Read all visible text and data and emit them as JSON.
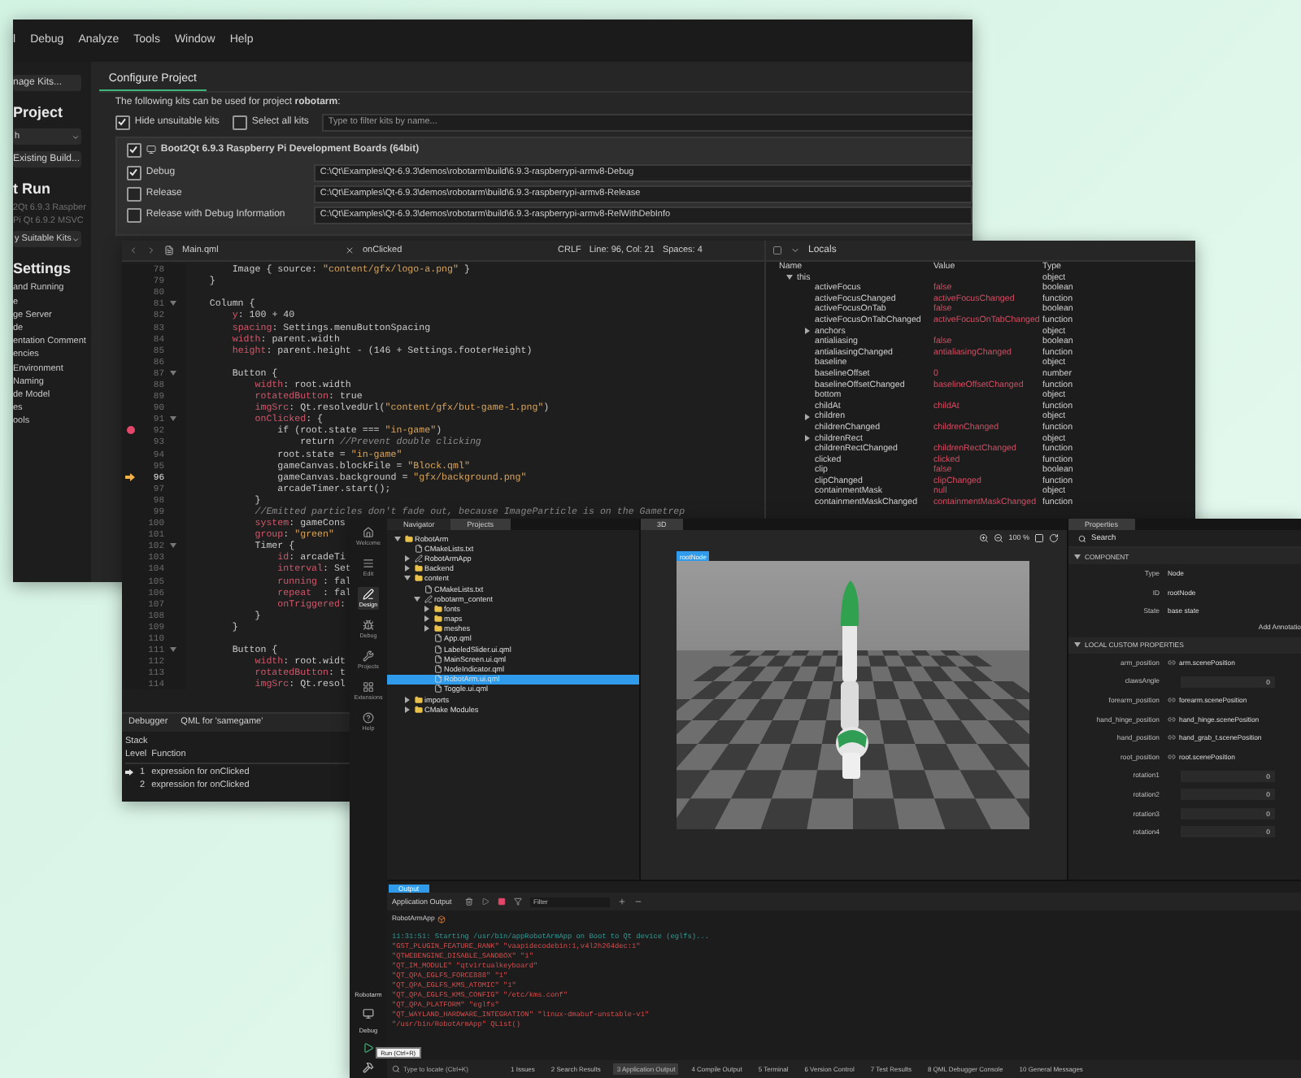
{
  "build_window": {
    "menu": [
      "l",
      "Debug",
      "Analyze",
      "Tools",
      "Window",
      "Help"
    ],
    "sidebar": [
      {
        "kind": "button",
        "text": "nage Kits..."
      },
      {
        "kind": "heading",
        "text": "Project"
      },
      {
        "kind": "dropdown",
        "text": "h"
      },
      {
        "kind": "button",
        "text": "Existing Build..."
      },
      {
        "kind": "heading",
        "text": "t Run"
      },
      {
        "kind": "faded",
        "text": "2Qt 6.9.3 Raspber"
      },
      {
        "kind": "faded",
        "text": "Pi Qt 6.9.2 MSVC"
      },
      {
        "kind": "dropdown",
        "text": "y Suitable Kits"
      },
      {
        "kind": "heading",
        "text": "Settings"
      },
      {
        "kind": "item",
        "text": "and Running"
      },
      {
        "kind": "item",
        "text": "e"
      },
      {
        "kind": "item",
        "text": "ge Server"
      },
      {
        "kind": "item",
        "text": "de"
      },
      {
        "kind": "item",
        "text": "entation Comment"
      },
      {
        "kind": "item",
        "text": "encies"
      },
      {
        "kind": "item",
        "text": "Environment"
      },
      {
        "kind": "item",
        "text": "Naming"
      },
      {
        "kind": "item",
        "text": "de Model"
      },
      {
        "kind": "item",
        "text": "es"
      },
      {
        "kind": "item",
        "text": "ools"
      }
    ],
    "tab": "Configure Project",
    "intro": "The following kits can be used for project **robotarm**:",
    "options": [
      {
        "label": "Hide unsuitable kits",
        "checked": true
      },
      {
        "label": "Select all kits",
        "checked": false
      }
    ],
    "filter_placeholder": "Type to filter kits by name...",
    "kit": {
      "name": "Boot2Qt 6.9.3 Raspberry Pi Development Boards (64bit)",
      "checked": true
    },
    "builds": [
      {
        "label": "Debug",
        "checked": true,
        "path": "C:\\Qt\\Examples\\Qt-6.9.3\\demos\\robotarm\\build\\6.9.3-raspberrypi-armv8-Debug"
      },
      {
        "label": "Release",
        "checked": false,
        "path": "C:\\Qt\\Examples\\Qt-6.9.3\\demos\\robotarm\\build\\6.9.3-raspberrypi-armv8-Release"
      },
      {
        "label": "Release with Debug Information",
        "checked": false,
        "path": "C:\\Qt\\Examples\\Qt-6.9.3\\demos\\robotarm\\build\\6.9.3-raspberrypi-armv8-RelWithDebInfo"
      }
    ]
  },
  "editor_window": {
    "file": "Main.qml",
    "symbol": "onClicked",
    "encoding": "CRLF",
    "position": "Line: 96, Col: 21",
    "indent": "Spaces: 4",
    "lines": [
      {
        "n": "78",
        "code": "        Image { source: \"content/gfx/logo-a.png\" }",
        "breakpoint": false,
        "current": false,
        "fold": false
      },
      {
        "n": "79",
        "code": "    }",
        "breakpoint": false,
        "current": false,
        "fold": false
      },
      {
        "n": "80",
        "breakpoint": false,
        "current": false,
        "fold": false
      },
      {
        "n": "81",
        "code": "    Column {",
        "breakpoint": false,
        "current": false,
        "fold": true
      },
      {
        "n": "82",
        "code": "        y: 100 + 40",
        "breakpoint": false,
        "current": false,
        "fold": false
      },
      {
        "n": "83",
        "code": "        spacing: Settings.menuButtonSpacing",
        "breakpoint": false,
        "current": false,
        "fold": false
      },
      {
        "n": "84",
        "code": "        width: parent.width",
        "breakpoint": false,
        "current": false,
        "fold": false
      },
      {
        "n": "85",
        "code": "        height: parent.height - (146 + Settings.footerHeight)",
        "breakpoint": false,
        "current": false,
        "fold": false
      },
      {
        "n": "86",
        "breakpoint": false,
        "current": false,
        "fold": false
      },
      {
        "n": "87",
        "code": "        Button {",
        "breakpoint": false,
        "current": false,
        "fold": true
      },
      {
        "n": "88",
        "code": "            width: root.width",
        "breakpoint": false,
        "current": false,
        "fold": false
      },
      {
        "n": "89",
        "code": "            rotatedButton: true",
        "breakpoint": false,
        "current": false,
        "fold": false
      },
      {
        "n": "90",
        "code": "            imgSrc: Qt.resolvedUrl(\"content/gfx/but-game-1.png\")",
        "breakpoint": false,
        "current": false,
        "fold": false
      },
      {
        "n": "91",
        "code": "            onClicked: {",
        "breakpoint": false,
        "current": false,
        "fold": true
      },
      {
        "n": "92",
        "code": "                if (root.state === \"in-game\")",
        "breakpoint": true,
        "current": false,
        "fold": false
      },
      {
        "n": "93",
        "code": "                    return //Prevent double clicking",
        "breakpoint": false,
        "current": false,
        "fold": false
      },
      {
        "n": "94",
        "code": "                root.state = \"in-game\"",
        "breakpoint": false,
        "current": false,
        "fold": false
      },
      {
        "n": "95",
        "code": "                gameCanvas.blockFile = \"Block.qml\"",
        "breakpoint": false,
        "current": false,
        "fold": false
      },
      {
        "n": "96",
        "code": "                gameCanvas.background = \"gfx/background.png\"",
        "breakpoint": false,
        "current": true,
        "fold": false
      },
      {
        "n": "97",
        "code": "                arcadeTimer.start();",
        "breakpoint": false,
        "current": false,
        "fold": false
      },
      {
        "n": "98",
        "code": "            }",
        "breakpoint": false,
        "current": false,
        "fold": false
      },
      {
        "n": "99",
        "code": "            //Emitted particles don't fade out, because ImageParticle is on the Gametrep",
        "breakpoint": false,
        "current": false,
        "fold": false
      },
      {
        "n": "100",
        "code": "            system: gameCons",
        "breakpoint": false,
        "current": false,
        "fold": false
      },
      {
        "n": "101",
        "code": "            group: \"green\"",
        "breakpoint": false,
        "current": false,
        "fold": false
      },
      {
        "n": "102",
        "code": "            Timer {",
        "breakpoint": false,
        "current": false,
        "fold": true
      },
      {
        "n": "103",
        "code": "                id: arcadeTi",
        "breakpoint": false,
        "current": false,
        "fold": false
      },
      {
        "n": "104",
        "code": "                interval: Set",
        "breakpoint": false,
        "current": false,
        "fold": false
      },
      {
        "n": "105",
        "code": "                running : fal",
        "breakpoint": false,
        "current": false,
        "fold": false
      },
      {
        "n": "106",
        "code": "                repeat  : fal",
        "breakpoint": false,
        "current": false,
        "fold": false
      },
      {
        "n": "107",
        "code": "                onTriggered:",
        "breakpoint": false,
        "current": false,
        "fold": false
      },
      {
        "n": "108",
        "code": "            }",
        "breakpoint": false,
        "current": false,
        "fold": false
      },
      {
        "n": "109",
        "code": "        }",
        "breakpoint": false,
        "current": false,
        "fold": false
      },
      {
        "n": "110",
        "breakpoint": false,
        "current": false,
        "fold": false
      },
      {
        "n": "111",
        "code": "        Button {",
        "breakpoint": false,
        "current": false,
        "fold": true
      },
      {
        "n": "112",
        "code": "            width: root.widt",
        "breakpoint": false,
        "current": false,
        "fold": false
      },
      {
        "n": "113",
        "code": "            rotatedButton: t",
        "breakpoint": false,
        "current": false,
        "fold": false
      },
      {
        "n": "114",
        "code": "            imgSrc: Qt.resol",
        "breakpoint": false,
        "current": false,
        "fold": false
      }
    ],
    "debugger": {
      "label": "Debugger",
      "engine": "QML for 'samegame'"
    },
    "stack": {
      "title": "Stack",
      "columns": [
        "Level",
        "Function"
      ],
      "rows": [
        {
          "level": "1",
          "function": "expression for onClicked",
          "current": true
        },
        {
          "level": "2",
          "function": "expression for onClicked",
          "current": false
        }
      ]
    },
    "locals": {
      "title": "Locals",
      "columns": [
        "Name",
        "Value",
        "Type"
      ],
      "rows": [
        {
          "name": "this",
          "type": "object",
          "expanded": true,
          "children": [
            {
              "name": "activeFocus",
              "value": "false",
              "type": "boolean"
            },
            {
              "name": "activeFocusChanged",
              "value": "activeFocusChanged",
              "type": "function"
            },
            {
              "name": "activeFocusOnTab",
              "value": "false",
              "type": "boolean"
            },
            {
              "name": "activeFocusOnTabChanged",
              "value": "activeFocusOnTabChanged",
              "type": "function"
            },
            {
              "name": "anchors",
              "type": "object",
              "expanded": false
            },
            {
              "name": "antialiasing",
              "value": "false",
              "type": "boolean"
            },
            {
              "name": "antialiasingChanged",
              "value": "antialiasingChanged",
              "type": "function"
            },
            {
              "name": "baseline",
              "type": "object"
            },
            {
              "name": "baselineOffset",
              "value": "0",
              "type": "number"
            },
            {
              "name": "baselineOffsetChanged",
              "value": "baselineOffsetChanged",
              "type": "function"
            },
            {
              "name": "bottom",
              "type": "object"
            },
            {
              "name": "childAt",
              "value": "childAt",
              "type": "function"
            },
            {
              "name": "children",
              "type": "object",
              "expanded": false
            },
            {
              "name": "childrenChanged",
              "value": "childrenChanged",
              "type": "function"
            },
            {
              "name": "childrenRect",
              "type": "object",
              "expanded": false
            },
            {
              "name": "childrenRectChanged",
              "value": "childrenRectChanged",
              "type": "function"
            },
            {
              "name": "clicked",
              "value": "clicked",
              "type": "function"
            },
            {
              "name": "clip",
              "value": "false",
              "type": "boolean"
            },
            {
              "name": "clipChanged",
              "value": "clipChanged",
              "type": "function"
            },
            {
              "name": "containmentMask",
              "value": "null",
              "type": "object"
            },
            {
              "name": "containmentMaskChanged",
              "value": "containmentMaskChanged",
              "type": "function"
            }
          ]
        }
      ]
    }
  },
  "studio_window": {
    "rail": [
      {
        "kind": "home",
        "label": "Welcome",
        "selected": false
      },
      {
        "kind": "edit",
        "label": "Edit",
        "selected": false
      },
      {
        "kind": "design",
        "label": "Design",
        "selected": true
      },
      {
        "kind": "debug",
        "label": "Debug",
        "selected": false
      },
      {
        "kind": "projects",
        "label": "Projects",
        "selected": false
      },
      {
        "kind": "extensions",
        "label": "Extensions",
        "selected": false
      },
      {
        "kind": "help",
        "label": "Help",
        "selected": false
      }
    ],
    "run_target": {
      "project": "Robotarm",
      "config": "Debug",
      "tooltip": "Run (Ctrl+R)"
    },
    "nav_tabs": [
      {
        "label": "Navigator",
        "selected": false
      },
      {
        "label": "Projects",
        "selected": true
      }
    ],
    "tree": [
      {
        "label": "RobotArm",
        "kind": "folder",
        "expanded": true,
        "selected": false,
        "children": [
          {
            "label": "CMakeLists.txt",
            "kind": "file",
            "selected": false
          },
          {
            "label": "RobotArmApp",
            "kind": "target",
            "expanded": false,
            "selected": false
          },
          {
            "label": "Backend",
            "kind": "folder",
            "expanded": false,
            "selected": false
          },
          {
            "label": "content",
            "kind": "folder",
            "expanded": true,
            "selected": false,
            "children": [
              {
                "label": "CMakeLists.txt",
                "kind": "file",
                "selected": false
              },
              {
                "label": "robotarm_content",
                "kind": "target",
                "expanded": true,
                "selected": false,
                "children": [
                  {
                    "label": "fonts",
                    "kind": "folder",
                    "expanded": false,
                    "selected": false
                  },
                  {
                    "label": "maps",
                    "kind": "folder",
                    "expanded": false,
                    "selected": false
                  },
                  {
                    "label": "meshes",
                    "kind": "folder",
                    "expanded": false,
                    "selected": false
                  },
                  {
                    "label": "App.qml",
                    "kind": "file",
                    "selected": false
                  },
                  {
                    "label": "LabeledSlider.ui.qml",
                    "kind": "file",
                    "selected": false
                  },
                  {
                    "label": "MainScreen.ui.qml",
                    "kind": "file",
                    "selected": false
                  },
                  {
                    "label": "NodeIndicator.qml",
                    "kind": "file",
                    "selected": false
                  },
                  {
                    "label": "RobotArm.ui.qml",
                    "kind": "file",
                    "selected": true
                  },
                  {
                    "label": "Toggle.ui.qml",
                    "kind": "file",
                    "selected": false
                  }
                ]
              }
            ]
          },
          {
            "label": "imports",
            "kind": "folder",
            "expanded": false,
            "selected": false
          },
          {
            "label": "CMake Modules",
            "kind": "folder",
            "expanded": false,
            "selected": false
          }
        ]
      }
    ],
    "view_tab": "3D",
    "zoom": "100 %",
    "node_label": "rootNode",
    "properties": {
      "tab": "Properties",
      "search": "Search",
      "component_title": "COMPONENT",
      "component": [
        {
          "label": "Type",
          "value": "Node"
        },
        {
          "label": "ID",
          "value": "rootNode"
        },
        {
          "label": "State",
          "value": "base state"
        }
      ],
      "annotation": "Add Annotatio",
      "custom_title": "LOCAL CUSTOM PROPERTIES",
      "custom": [
        {
          "label": "arm_position",
          "kind": "binding",
          "value": "arm.scenePosition"
        },
        {
          "label": "clawsAngle",
          "kind": "number",
          "value": "0"
        },
        {
          "label": "forearm_position",
          "kind": "binding",
          "value": "forearm.scenePosition"
        },
        {
          "label": "hand_hinge_position",
          "kind": "binding",
          "value": "hand_hinge.scenePosition"
        },
        {
          "label": "hand_position",
          "kind": "binding",
          "value": "hand_grab_t.scenePosition"
        },
        {
          "label": "root_position",
          "kind": "binding",
          "value": "root.scenePosition"
        },
        {
          "label": "rotation1",
          "kind": "number",
          "value": "0"
        },
        {
          "label": "rotation2",
          "kind": "number",
          "value": "0"
        },
        {
          "label": "rotation3",
          "kind": "number",
          "value": "0"
        },
        {
          "label": "rotation4",
          "kind": "number",
          "value": "0"
        }
      ]
    },
    "output": {
      "tab": "Output",
      "title": "Application Output",
      "filter_placeholder": "Filter",
      "app_tab": "RobotArmApp",
      "log": [
        {
          "kind": "info",
          "text": "11:31:51: Starting /usr/bin/appRobotArmApp on Boot to Qt device (eglfs)..."
        },
        {
          "kind": "env",
          "text": "\"GST_PLUGIN_FEATURE_RANK\" \"vaapidecodebin:1,v4l2h264dec:1\""
        },
        {
          "kind": "env",
          "text": "\"QTWEBENGINE_DISABLE_SANDBOX\" \"1\""
        },
        {
          "kind": "env",
          "text": "\"QT_IM_MODULE\" \"qtvirtualkeyboard\""
        },
        {
          "kind": "env",
          "text": "\"QT_QPA_EGLFS_FORCE888\" \"1\""
        },
        {
          "kind": "env",
          "text": "\"QT_QPA_EGLFS_KMS_ATOMIC\" \"1\""
        },
        {
          "kind": "env",
          "text": "\"QT_QPA_EGLFS_KMS_CONFIG\" \"/etc/kms.conf\""
        },
        {
          "kind": "env",
          "text": "\"QT_QPA_PLATFORM\" \"eglfs\""
        },
        {
          "kind": "env",
          "text": "\"QT_WAYLAND_HARDWARE_INTEGRATION\" \"linux-dmabuf-unstable-v1\""
        },
        {
          "kind": "env",
          "text": "\"/usr/bin/RobotArmApp\" QList()"
        }
      ]
    },
    "status": {
      "locator": "Type to locate (Ctrl+K)",
      "panes": [
        {
          "label": "1  Issues",
          "selected": false
        },
        {
          "label": "2  Search Results",
          "selected": false
        },
        {
          "label": "3  Application Output",
          "selected": true
        },
        {
          "label": "4  Compile Output",
          "selected": false
        },
        {
          "label": "5  Terminal",
          "selected": false
        },
        {
          "label": "6  Version Control",
          "selected": false
        },
        {
          "label": "7  Test Results",
          "selected": false
        },
        {
          "label": "8  QML Debugger Console",
          "selected": false
        },
        {
          "label": "10  General Messages",
          "selected": false
        }
      ]
    }
  }
}
